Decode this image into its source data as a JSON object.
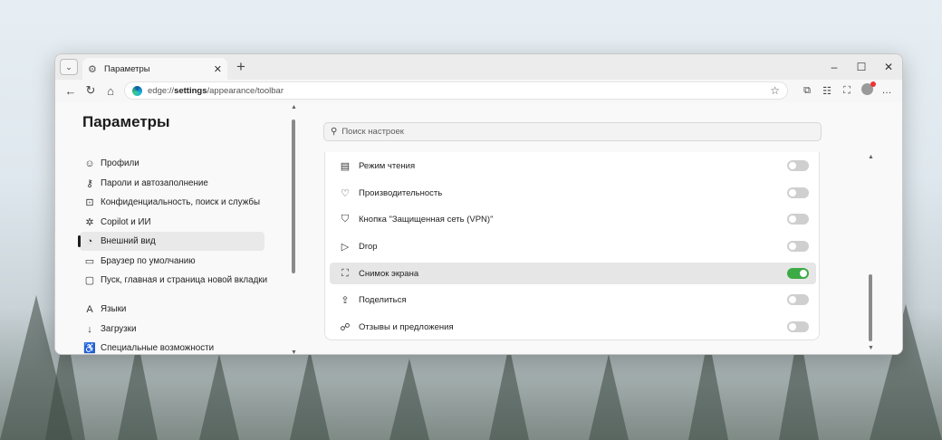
{
  "browser": {
    "tab": {
      "title": "Параметры"
    },
    "url": {
      "prefix": "edge://",
      "bold": "settings",
      "rest": "/appearance/toolbar"
    }
  },
  "sidebar": {
    "title": "Параметры",
    "items": [
      {
        "label": "Профили",
        "icon": "profile-icon",
        "glyph": "☺",
        "active": false
      },
      {
        "label": "Пароли и автозаполнение",
        "icon": "key-icon",
        "glyph": "⚷",
        "active": false
      },
      {
        "label": "Конфиденциальность, поиск и службы",
        "icon": "lock-icon",
        "glyph": "⊡",
        "active": false
      },
      {
        "label": "Copilot и ИИ",
        "icon": "copilot-icon",
        "glyph": "✲",
        "active": false
      },
      {
        "label": "Внешний вид",
        "icon": "appearance-icon",
        "glyph": "◔",
        "active": true
      },
      {
        "label": "Браузер по умолчанию",
        "icon": "browser-icon",
        "glyph": "▭",
        "active": false
      },
      {
        "label": "Пуск, главная и страница новой вкладки",
        "icon": "home-page-icon",
        "glyph": "▢",
        "active": false
      },
      {
        "label": "Языки",
        "icon": "languages-icon",
        "glyph": "A",
        "active": false
      },
      {
        "label": "Загрузки",
        "icon": "download-icon",
        "glyph": "↓",
        "active": false
      },
      {
        "label": "Специальные возможности",
        "icon": "accessibility-icon",
        "glyph": "♿",
        "active": false
      }
    ]
  },
  "search": {
    "placeholder": "Поиск настроек"
  },
  "toolbar_items": [
    {
      "label": "Режим чтения",
      "icon": "reading-mode-icon",
      "glyph": "▤",
      "on": false
    },
    {
      "label": "Производительность",
      "icon": "performance-icon",
      "glyph": "♡",
      "on": false
    },
    {
      "label": "Кнопка \"Защищенная сеть (VPN)\"",
      "icon": "vpn-shield-icon",
      "glyph": "⛉",
      "on": false
    },
    {
      "label": "Drop",
      "icon": "drop-icon",
      "glyph": "▷",
      "on": false
    },
    {
      "label": "Снимок экрана",
      "icon": "screenshot-icon",
      "glyph": "⛶",
      "on": true
    },
    {
      "label": "Поделиться",
      "icon": "share-icon",
      "glyph": "⇪",
      "on": false
    },
    {
      "label": "Отзывы и предложения",
      "icon": "feedback-icon",
      "glyph": "☍",
      "on": false
    }
  ]
}
